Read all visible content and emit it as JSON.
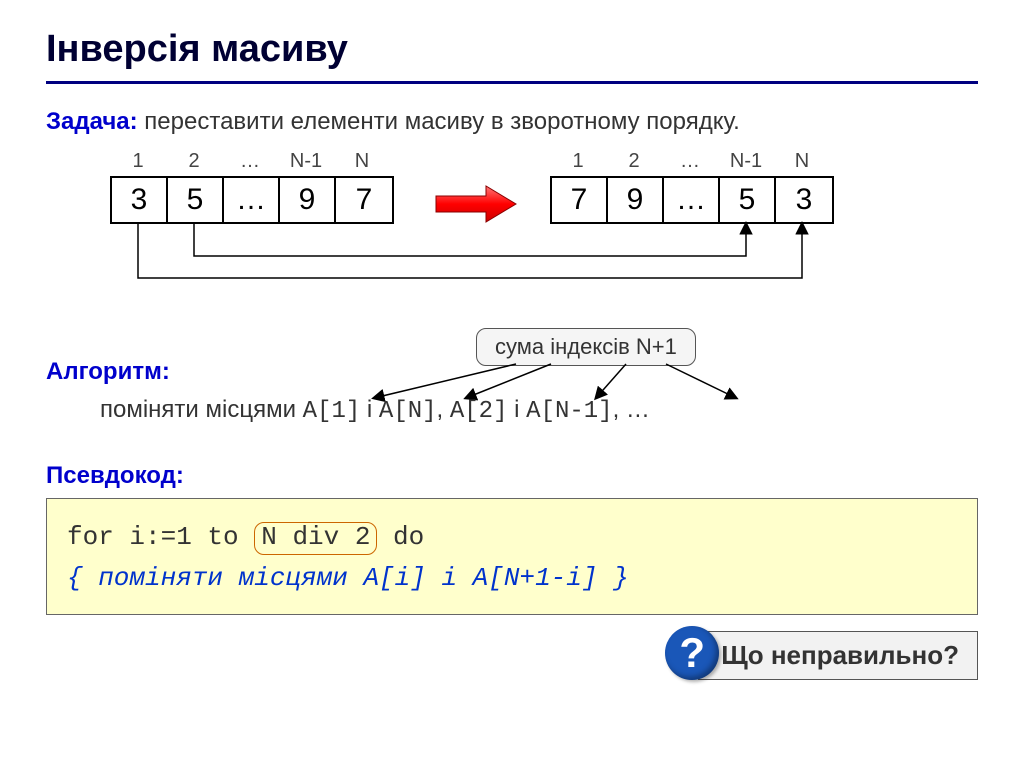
{
  "title": "Інверсія масиву",
  "task": {
    "label": "Задача:",
    "text": " переставити елементи масиву в зворотному порядку."
  },
  "array": {
    "idx": [
      "1",
      "2",
      "…",
      "N-1",
      "N"
    ],
    "left": [
      "3",
      "5",
      "…",
      "9",
      "7"
    ],
    "right": [
      "7",
      "9",
      "…",
      "5",
      "3"
    ]
  },
  "algo": {
    "label": "Алгоритм:",
    "tip": "сума індексів N+1",
    "line_pre": "поміняти місцями ",
    "p1a": "A[1]",
    "p1j": " і ",
    "p1b": "A[N]",
    "sep": ", ",
    "p2a": "A[2]",
    "p2j": " і ",
    "p2b": "A[N-1]",
    "tail": ", …"
  },
  "pseudo_label": "Псевдокод:",
  "code": {
    "l1a": "for i:=1 to ",
    "l1_hl": "N div 2",
    "l1b": " do",
    "l2": " { поміняти місцями A[i] і A[N+1-i] }"
  },
  "question": "Що неправильно?",
  "qmark": "?"
}
